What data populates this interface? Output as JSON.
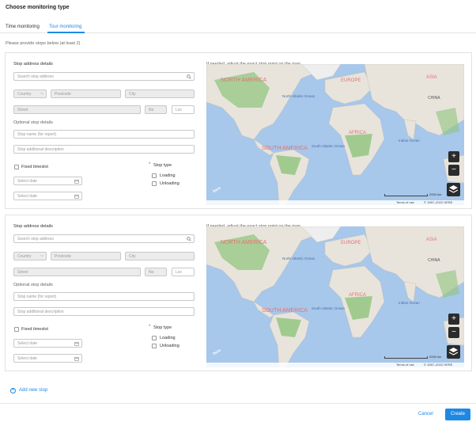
{
  "dialog": {
    "title": "Choose monitoring type"
  },
  "tabs": [
    {
      "label": "Time monitoring"
    },
    {
      "label": "Tour monitoring",
      "active": true
    }
  ],
  "hint": "Please provide stops below (at least 2)",
  "stops": [
    {
      "address_label": "Stop address details",
      "search_placeholder": "Search stop address",
      "country_placeholder": "Country",
      "postcode_placeholder": "Postcode",
      "city_placeholder": "City",
      "street_placeholder": "Street",
      "no_placeholder": "No",
      "loc_placeholder": "Loc",
      "optional_label": "Optional stop details",
      "name_placeholder": "Stop name (for report)",
      "desc_placeholder": "Stop additional description",
      "fixed_timeslot_label": "Fixed timeslot",
      "date1_placeholder": "Select date",
      "date2_placeholder": "Select date",
      "stop_type_label": "Stop type",
      "loading_label": "Loading",
      "unloading_label": "Unloading",
      "map_hint": "If needed, adjust the exact stop point on the map",
      "map": {
        "labels": {
          "north_america": "NORTH AMERICA",
          "europe": "EUROPE",
          "asia": "ASIA",
          "north_atlantic": "North Atlantic Ocean",
          "china": "CHINA",
          "south_america": "SOUTH AMERICA",
          "africa": "AFRICA",
          "south_atlantic": "South Atlantic Ocean",
          "indian_ocean": "Indian Ocean"
        },
        "scale": "2000 km",
        "terms": "Terms of use",
        "copyright": "© 1987–2022 HERE",
        "logo": "here"
      }
    },
    {
      "address_label": "Stop address details",
      "search_placeholder": "Search stop address",
      "country_placeholder": "Country",
      "postcode_placeholder": "Postcode",
      "city_placeholder": "City",
      "street_placeholder": "Street",
      "no_placeholder": "No",
      "loc_placeholder": "Loc",
      "optional_label": "Optional stop details",
      "name_placeholder": "Stop name (for report)",
      "desc_placeholder": "Stop additional description",
      "fixed_timeslot_label": "Fixed timeslot",
      "date1_placeholder": "Select date",
      "date2_placeholder": "Select date",
      "stop_type_label": "Stop type",
      "loading_label": "Loading",
      "unloading_label": "Unloading",
      "map_hint": "If needed, adjust the exact stop point on the map",
      "map": {
        "labels": {
          "north_america": "NORTH AMERICA",
          "europe": "EUROPE",
          "asia": "ASIA",
          "north_atlantic": "North Atlantic Ocean",
          "china": "CHINA",
          "south_america": "SOUTH AMERICA",
          "africa": "AFRICA",
          "south_atlantic": "South Atlantic Ocean",
          "indian_ocean": "Indian Ocean"
        },
        "scale": "2000 km",
        "terms": "Terms of use",
        "copyright": "© 1987–2022 HERE",
        "logo": "here"
      }
    }
  ],
  "add_stop_label": "Add new stop",
  "footer": {
    "cancel_label": "Cancel",
    "create_label": "Create"
  },
  "colors": {
    "accent": "#1e88e5",
    "map_water": "#a7c7eb",
    "map_land": "#e8e4dc",
    "map_green": "#8fc47b"
  }
}
